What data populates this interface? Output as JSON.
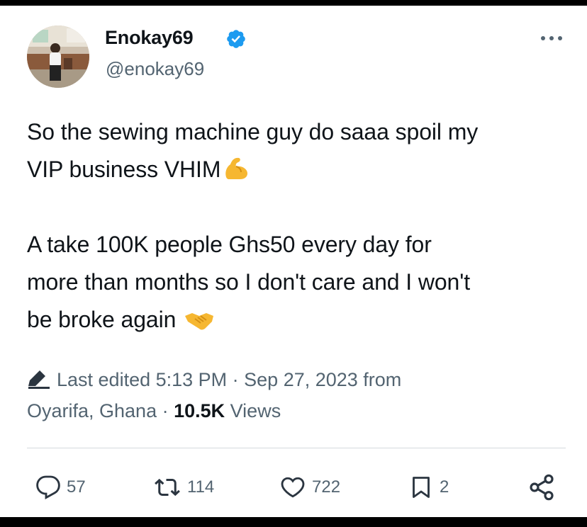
{
  "author": {
    "display_name": "Enokay69",
    "handle": "@enokay69",
    "verified_color": "#1d9bf0"
  },
  "more_icon": "more-horizontal-icon",
  "tweet": {
    "lines": [
      "So the sewing machine guy do saaa spoil my",
      "VIP business VHIM",
      "A take 100K people Ghs50 every day for",
      "more than months so I don't care and I won't",
      "be broke again "
    ],
    "emoji": [
      "flexed-biceps-emoji",
      "handshake-emoji"
    ]
  },
  "meta": {
    "edited": "Last edited 5:13 PM · Sep 27, 2023 from",
    "location": "Oyarifa, Ghana · ",
    "views_count": "10.5K",
    "views_label": " Views"
  },
  "actions": {
    "replies": "57",
    "reposts": "114",
    "likes": "722",
    "bookmarks": "2"
  },
  "colors": {
    "text": "#0f1419",
    "secondary": "#536471",
    "accent": "#1d9bf0"
  }
}
